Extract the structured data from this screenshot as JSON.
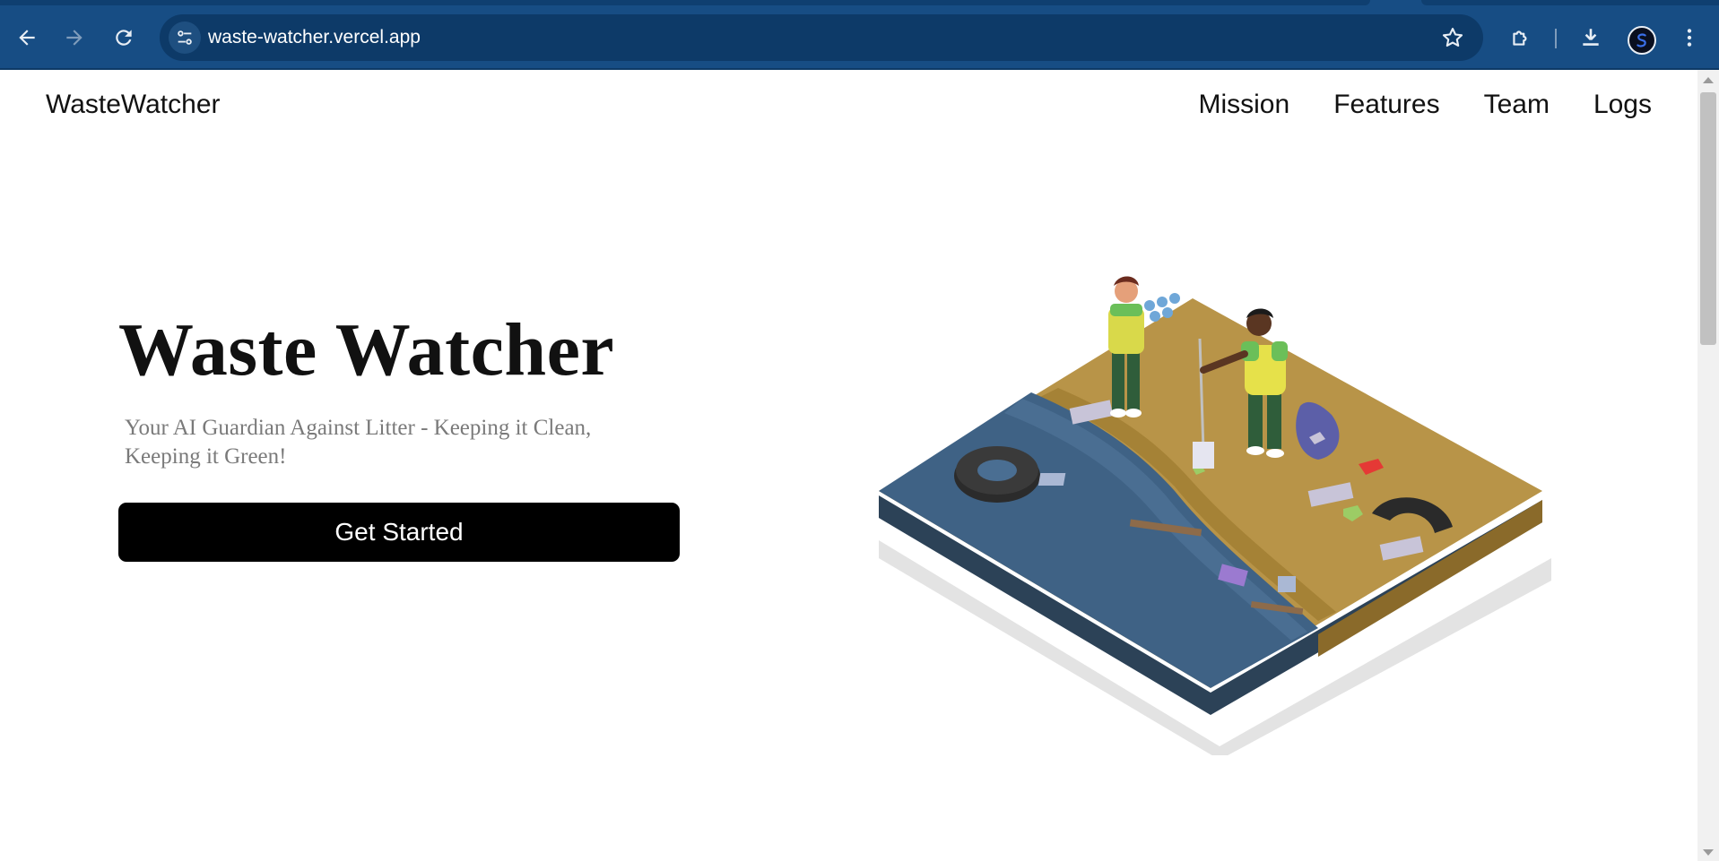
{
  "browser": {
    "url": "waste-watcher.vercel.app",
    "icons": [
      "back-icon",
      "forward-icon",
      "reload-icon",
      "site-settings-icon",
      "bookmark-star-icon",
      "extensions-icon",
      "download-icon",
      "avatar",
      "more-menu-icon"
    ]
  },
  "site": {
    "brand": "WasteWatcher",
    "nav": [
      "Mission",
      "Features",
      "Team",
      "Logs"
    ]
  },
  "hero": {
    "title": "Waste Watcher",
    "subtitle": "Your AI Guardian Against Litter - Keeping it Clean, Keeping it Green!",
    "cta": "Get Started"
  },
  "colors": {
    "chrome": "#174d84",
    "cta_bg": "#000000",
    "water": "#3f6285",
    "sand": "#b89448"
  }
}
